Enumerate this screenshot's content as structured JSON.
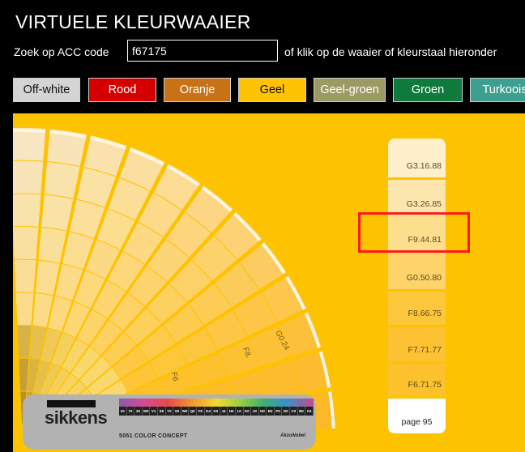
{
  "app": {
    "title": "VIRTUELE KLEURWAAIER"
  },
  "search": {
    "label": "Zoek op ACC code",
    "value": "f67175",
    "hint": "of klik op de waaier of kleurstaal hieronder"
  },
  "tabs": [
    {
      "label": "Off-white",
      "bg": "#D4D4D4",
      "fg": "#111111"
    },
    {
      "label": "Rood",
      "bg": "#D40000",
      "fg": "#FFFFFF"
    },
    {
      "label": "Oranje",
      "bg": "#C87217",
      "fg": "#FFFFFF"
    },
    {
      "label": "Geel",
      "bg": "#FEC300",
      "fg": "#111111"
    },
    {
      "label": "Geel-groen",
      "bg": "#9C9A63",
      "fg": "#FFFFFF"
    },
    {
      "label": "Groen",
      "bg": "#0F7A3C",
      "fg": "#FFFFFF"
    },
    {
      "label": "Turkoois",
      "bg": "#3E9E90",
      "fg": "#FFFFFF"
    }
  ],
  "fan": {
    "leaf_labels": [
      "F6",
      "F8.",
      "G0.24"
    ]
  },
  "swatch_card": {
    "swatches": [
      {
        "code": "G3.16.88",
        "color": "#FDF0CB"
      },
      {
        "code": "G3.26.85",
        "color": "#FCE6AE"
      },
      {
        "code": "F9.44.81",
        "color": "#FDDE8D"
      },
      {
        "code": "G0.50.80",
        "color": "#FDD36A"
      },
      {
        "code": "F8.66.75",
        "color": "#FCC73A"
      },
      {
        "code": "F7.71.77",
        "color": "#FDC233"
      },
      {
        "code": "F6.71.75",
        "color": "#FDC12E"
      }
    ],
    "page_label": "page 95",
    "selected_code": "F9.44.81"
  },
  "brand": {
    "logo": "sikkens",
    "concept": "5051 COLOR CONCEPT",
    "maker": "AkzoNobel"
  },
  "colors": {
    "background": "#000000",
    "stage": "#FEC300",
    "highlight": "#FF1A1A"
  }
}
